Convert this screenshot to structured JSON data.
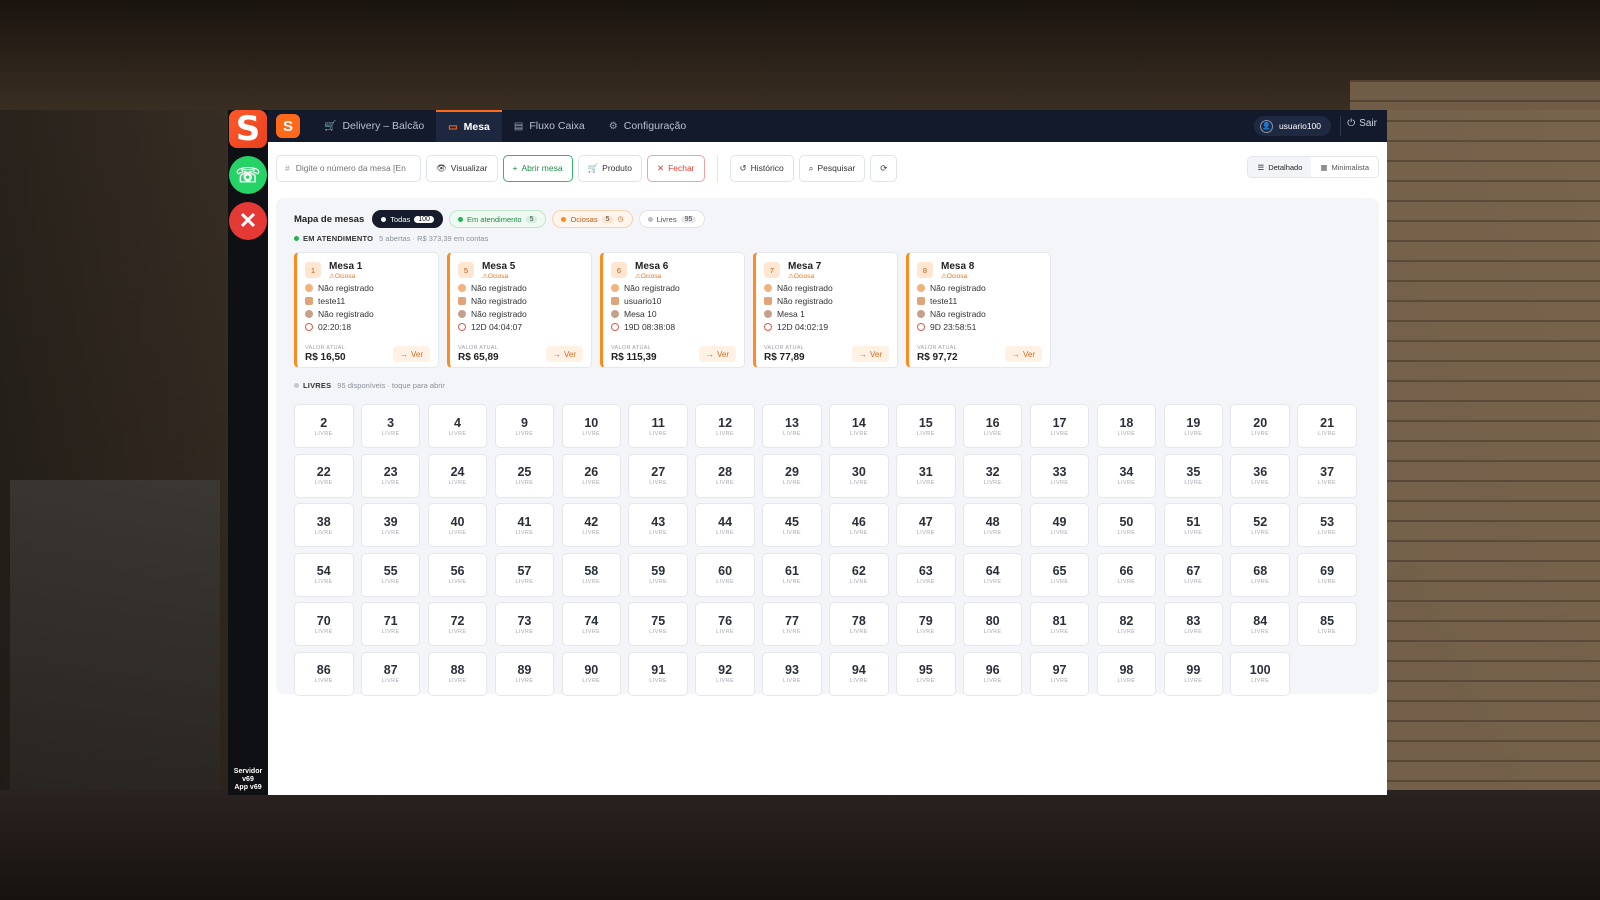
{
  "rail": {
    "logo": "S",
    "whatsapp": "☏",
    "close": "✕",
    "version_lines": [
      "Servidor",
      "v69",
      "App v69"
    ]
  },
  "topbar": {
    "logo": "S",
    "tabs": [
      {
        "label": "Delivery – Balcão",
        "icon": "cart-icon"
      },
      {
        "label": "Mesa",
        "icon": "table-icon",
        "active": true
      },
      {
        "label": "Fluxo Caixa",
        "icon": "cash-icon"
      },
      {
        "label": "Configuração",
        "icon": "gear-icon"
      }
    ],
    "user": "usuario100",
    "logout": "Sair"
  },
  "toolbar": {
    "search_placeholder": "Digite o número da mesa [Ente",
    "visualizar": "Visualizar",
    "abrir_mesa": "Abrir mesa",
    "produto": "Produto",
    "fechar": "Fechar",
    "historico": "Histórico",
    "pesquisar": "Pesquisar",
    "view_detalhado": "Detalhado",
    "view_minimalista": "Minimalista"
  },
  "map": {
    "title": "Mapa de mesas",
    "filters": [
      {
        "label": "Todas",
        "count": "100"
      },
      {
        "label": "Em atendimento",
        "count": "5"
      },
      {
        "label": "Ociosas",
        "count": "5"
      },
      {
        "label": "Livres",
        "count": "95"
      }
    ]
  },
  "em_atendimento": {
    "title": "EM ATENDIMENTO",
    "subtitle": "5 abertas · R$ 373,39 em contas",
    "value_label": "VALOR ATUAL",
    "ver_label": "Ver",
    "cards": [
      {
        "num": "1",
        "name": "Mesa 1",
        "status": "Ociosa",
        "cliente": "Não registrado",
        "garcom": "teste11",
        "local": "Não registrado",
        "tempo": "02:20:18",
        "valor": "R$ 16,50"
      },
      {
        "num": "5",
        "name": "Mesa 5",
        "status": "Ociosa",
        "cliente": "Não registrado",
        "garcom": "Não registrado",
        "local": "Não registrado",
        "tempo": "12D 04:04:07",
        "valor": "R$ 65,89"
      },
      {
        "num": "6",
        "name": "Mesa 6",
        "status": "Ociosa",
        "cliente": "Não registrado",
        "garcom": "usuario10",
        "local": "Mesa 10",
        "tempo": "19D 08:38:08",
        "valor": "R$ 115,39"
      },
      {
        "num": "7",
        "name": "Mesa 7",
        "status": "Ociosa",
        "cliente": "Não registrado",
        "garcom": "Não registrado",
        "local": "Mesa 1",
        "tempo": "12D 04:02:19",
        "valor": "R$ 77,89"
      },
      {
        "num": "8",
        "name": "Mesa 8",
        "status": "Ociosa",
        "cliente": "Não registrado",
        "garcom": "teste11",
        "local": "Não registrado",
        "tempo": "9D 23:58:51",
        "valor": "R$ 97,72"
      }
    ]
  },
  "livres": {
    "title": "LIVRES",
    "subtitle": "95 disponíveis · toque para abrir",
    "cell_label": "LIVRE",
    "tables": [
      "2",
      "3",
      "4",
      "9",
      "10",
      "11",
      "12",
      "13",
      "14",
      "15",
      "16",
      "17",
      "18",
      "19",
      "20",
      "21",
      "22",
      "23",
      "24",
      "25",
      "26",
      "27",
      "28",
      "29",
      "30",
      "31",
      "32",
      "33",
      "34",
      "35",
      "36",
      "37",
      "38",
      "39",
      "40",
      "41",
      "42",
      "43",
      "44",
      "45",
      "46",
      "47",
      "48",
      "49",
      "50",
      "51",
      "52",
      "53",
      "54",
      "55",
      "56",
      "57",
      "58",
      "59",
      "60",
      "61",
      "62",
      "63",
      "64",
      "65",
      "66",
      "67",
      "68",
      "69",
      "70",
      "71",
      "72",
      "73",
      "74",
      "75",
      "76",
      "77",
      "78",
      "79",
      "80",
      "81",
      "82",
      "83",
      "84",
      "85",
      "86",
      "87",
      "88",
      "89",
      "90",
      "91",
      "92",
      "93",
      "94",
      "95",
      "96",
      "97",
      "98",
      "99",
      "100"
    ]
  },
  "colors": {
    "accent": "#ff6a1a",
    "navy": "#121a2b",
    "green": "#22b24f",
    "red": "#e23d31"
  }
}
